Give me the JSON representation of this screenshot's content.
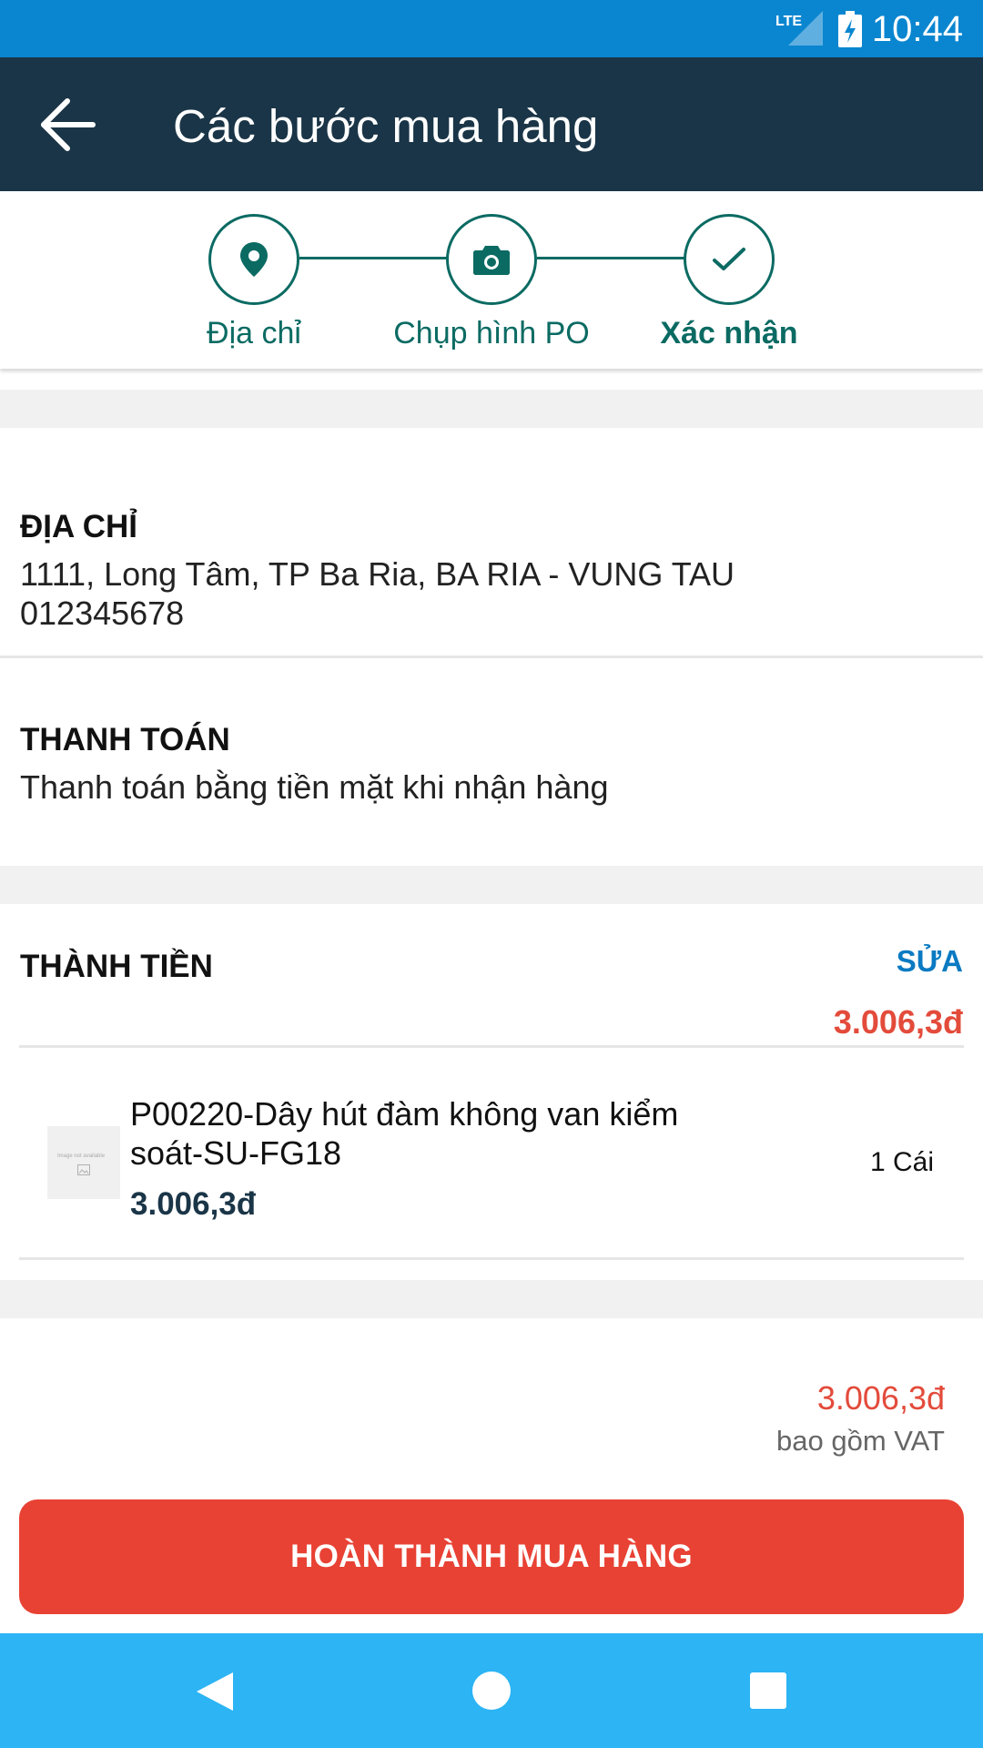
{
  "status_bar": {
    "network": "LTE",
    "time": "10:44"
  },
  "app_bar": {
    "title": "Các bước mua hàng"
  },
  "steps": [
    {
      "label": "Địa chỉ",
      "icon": "location-pin-icon"
    },
    {
      "label": "Chụp hình PO",
      "icon": "camera-icon"
    },
    {
      "label": "Xác nhận",
      "icon": "check-icon",
      "active": true
    }
  ],
  "address": {
    "heading": "ĐỊA CHỈ",
    "line1": "1111, Long Tâm, TP Ba Ria, BA RIA - VUNG TAU",
    "phone": "012345678"
  },
  "payment": {
    "heading": "THANH TOÁN",
    "method": "Thanh toán bằng tiền mặt khi nhận hàng"
  },
  "order": {
    "heading": "THÀNH TIỀN",
    "edit_label": "SỬA",
    "subtotal": "3.006,3đ",
    "items": [
      {
        "name": "P00220-Dây hút đàm không van kiểm soát-SU-FG18",
        "price": "3.006,3đ",
        "quantity": "1 Cái",
        "thumbnail_text": "Image not available"
      }
    ]
  },
  "summary": {
    "total": "3.006,3đ",
    "vat_note": "bao gồm VAT"
  },
  "finish_button": {
    "label": "HOÀN THÀNH MUA HÀNG"
  },
  "colors": {
    "status_bar": "#0a86d0",
    "app_bar": "#1a3547",
    "accent_teal": "#0b6b63",
    "price_red": "#e34b3b",
    "edit_blue": "#0a7ac2",
    "button_red": "#e84234",
    "nav_bar": "#2cb4f4"
  }
}
